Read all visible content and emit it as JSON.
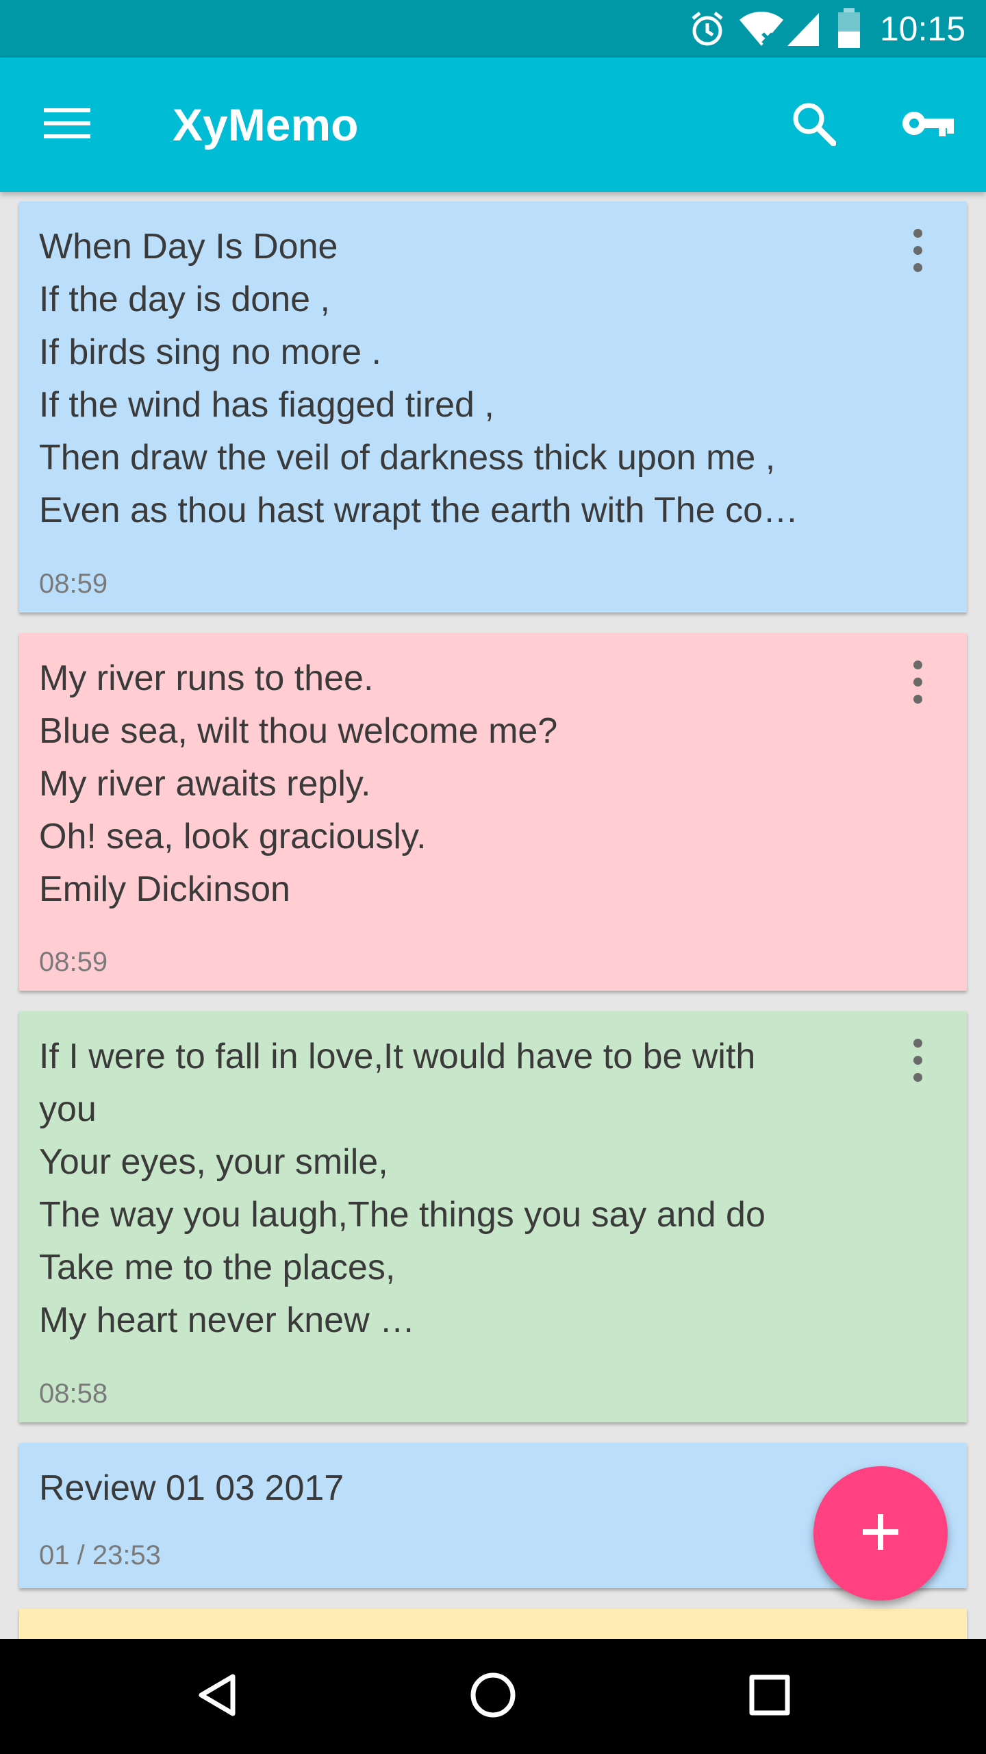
{
  "status_bar": {
    "time": "10:15",
    "icons": [
      "alarm-icon",
      "wifi-icon",
      "signal-icon",
      "battery-icon"
    ]
  },
  "app_bar": {
    "title": "XyMemo",
    "icons": [
      "menu-icon",
      "search-icon",
      "key-icon"
    ],
    "color": "#00bcd4"
  },
  "memos": [
    {
      "color": "#bbdefb",
      "lines": [
        "When Day Is Done",
        "If the day is done ,",
        "If birds sing no more .",
        "If the wind has fiagged tired ,",
        "Then draw the veil of darkness thick upon me ,",
        "Even as thou hast wrapt the earth with The co…"
      ],
      "time": "08:59"
    },
    {
      "color": "#ffcdd2",
      "lines": [
        "My river runs to thee.",
        "Blue sea, wilt thou welcome me?",
        "My river awaits reply.",
        "Oh! sea, look graciously.",
        "Emily Dickinson"
      ],
      "time": "08:59"
    },
    {
      "color": "#c8e6c9",
      "lines": [
        "If I were to fall in love,It would have to be with",
        "you",
        "Your eyes, your smile,",
        "The way you laugh,The things you say and do",
        "Take me to the places,",
        "My heart never knew …"
      ],
      "time": "08:58"
    },
    {
      "color": "#bbdefb",
      "lines": [
        "Review 01 03 2017"
      ],
      "time": "01 / 23:53"
    },
    {
      "color": "#ffecb3",
      "lines": [],
      "time": ""
    }
  ],
  "fab": {
    "icon": "plus-icon",
    "color": "#ff4081"
  },
  "nav_bar": {
    "icons": [
      "back-icon",
      "home-icon",
      "recents-icon"
    ]
  }
}
